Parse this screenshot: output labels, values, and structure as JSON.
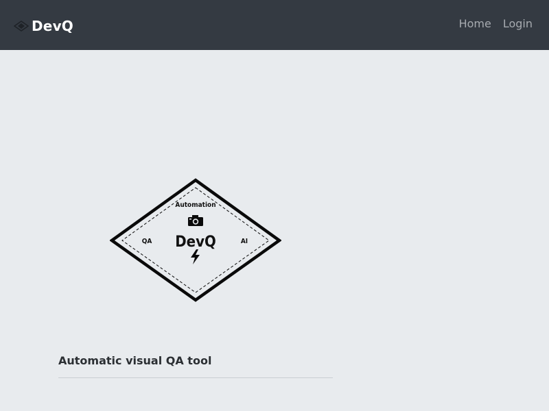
{
  "navbar": {
    "brand": "DevQ",
    "brand_icon": "diamond-logo-icon",
    "links": [
      {
        "label": "Home"
      },
      {
        "label": "Login"
      }
    ]
  },
  "badge": {
    "top_label": "Automation",
    "left_label": "QA",
    "right_label": "AI",
    "center_label": "DevQ",
    "top_icon": "camera-icon",
    "bottom_icon": "lightning-bolt-icon"
  },
  "hero": {
    "tagline": "Automatic visual QA tool"
  },
  "colors": {
    "navbar_bg": "#343a42",
    "page_bg": "#e8ebee",
    "nav_link": "#a7abb0",
    "brand_text": "#ffffff"
  }
}
